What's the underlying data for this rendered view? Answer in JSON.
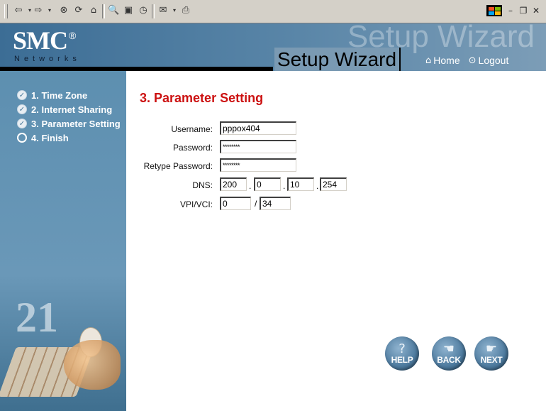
{
  "toolbar": {
    "icons": [
      "back-icon",
      "forward-icon",
      "stop-icon",
      "refresh-icon",
      "home-icon",
      "search-icon",
      "favorites-icon",
      "history-icon",
      "mail-icon",
      "print-icon"
    ]
  },
  "header": {
    "logo": "SMC",
    "logo_mark": "®",
    "logo_sub": "Networks",
    "ghost_title": "Setup Wizard",
    "title": "Setup Wizard",
    "home_label": "Home",
    "logout_label": "Logout"
  },
  "sidebar": {
    "steps": [
      {
        "label": "1. Time Zone",
        "status": "done"
      },
      {
        "label": "2. Internet Sharing",
        "status": "done"
      },
      {
        "label": "3. Parameter Setting",
        "status": "done"
      },
      {
        "label": "4. Finish",
        "status": "todo"
      }
    ],
    "image_text": "21"
  },
  "main": {
    "heading": "3. Parameter Setting",
    "username": {
      "label": "Username:",
      "value": "pppox404"
    },
    "password": {
      "label": "Password:",
      "value": "********"
    },
    "retype_password": {
      "label": "Retype Password:",
      "value": "********"
    },
    "dns": {
      "label": "DNS:",
      "octets": [
        "200",
        "0",
        "10",
        "254"
      ],
      "separator": "."
    },
    "vpi_vci": {
      "label": "VPI/VCI:",
      "vpi": "0",
      "vci": "34",
      "separator": "/"
    }
  },
  "buttons": {
    "help": "HELP",
    "back": "BACK",
    "next": "NEXT"
  },
  "colors": {
    "header_blue": "#3c6d95",
    "sidebar_blue": "#5d8fb0",
    "heading_red": "#cc1111"
  }
}
